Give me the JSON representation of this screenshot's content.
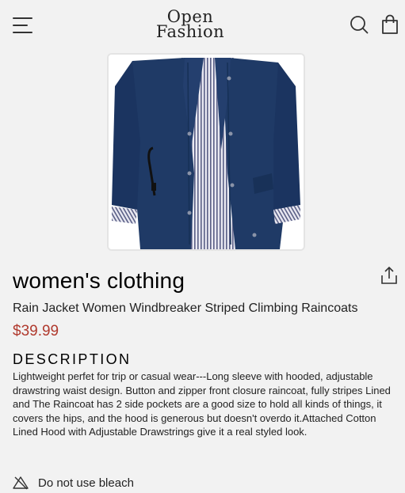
{
  "header": {
    "logo_line1": "Open",
    "logo_line2": "Fashion",
    "icons": [
      "menu-icon",
      "search-icon",
      "shopping-bag-icon"
    ]
  },
  "product": {
    "image": "navy-raincoat-product-image",
    "title": "women's clothing",
    "name": "Rain Jacket Women Windbreaker Striped Climbing Raincoats",
    "price": "$39.99",
    "share_icon": "share-icon"
  },
  "description": {
    "heading": "DESCRIPTION",
    "text": "Lightweight perfet for trip or casual wear---Long sleeve with hooded, adjustable drawstring waist design. Button and zipper front closure raincoat, fully stripes Lined and The Raincoat has 2 side pockets are a good size to hold all kinds of things, it covers the hips, and the hood is generous but doesn't overdo it.Attached Cotton Lined Hood with Adjustable Drawstrings give it a real styled look."
  },
  "care": [
    {
      "icon": "no-bleach-icon",
      "label": "Do not use bleach"
    }
  ],
  "colors": {
    "background": "#f2f2f2",
    "price": "#b03a2e",
    "jacket": "#1f3a66"
  }
}
